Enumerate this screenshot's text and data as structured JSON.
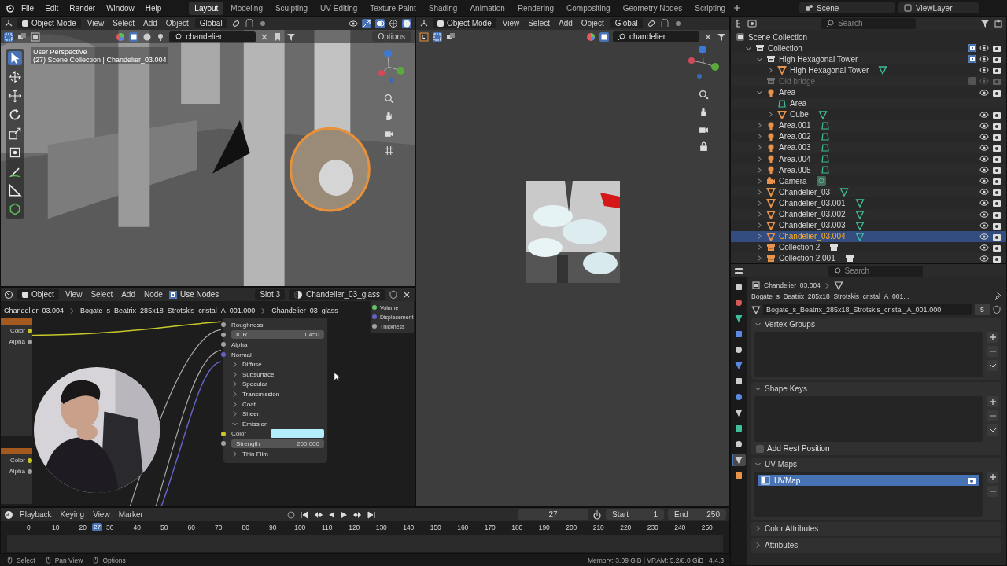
{
  "menu": [
    "File",
    "Edit",
    "Render",
    "Window",
    "Help"
  ],
  "workspaces": [
    {
      "label": "Layout",
      "selected": true
    },
    {
      "label": "Modeling",
      "selected": false
    },
    {
      "label": "Sculpting",
      "selected": false
    },
    {
      "label": "UV Editing",
      "selected": false
    },
    {
      "label": "Texture Paint",
      "selected": false
    },
    {
      "label": "Shading",
      "selected": false
    },
    {
      "label": "Animation",
      "selected": false
    },
    {
      "label": "Rendering",
      "selected": false
    },
    {
      "label": "Compositing",
      "selected": false
    },
    {
      "label": "Geometry Nodes",
      "selected": false
    },
    {
      "label": "Scripting",
      "selected": false
    }
  ],
  "scene": "Scene",
  "view_layer": "ViewLayer",
  "viewport_left": {
    "mode": "Object Mode",
    "menus": [
      "View",
      "Select",
      "Add",
      "Object"
    ],
    "orientation": "Global",
    "search": "chandelier",
    "options": "Options",
    "overlay_title": "User Perspective",
    "overlay_info": "(27) Scene Collection | Chandelier_03.004"
  },
  "viewport_right": {
    "mode": "Object Mode",
    "menus": [
      "View",
      "Select",
      "Add",
      "Object"
    ],
    "orientation": "Global",
    "search": "chandelier"
  },
  "outliner": {
    "search_placeholder": "Search",
    "root": "Scene Collection",
    "tree": [
      {
        "name": "Collection",
        "kind": "collection",
        "expanded": true,
        "checked": true,
        "selected": false,
        "disabled": false,
        "children": [
          {
            "name": "High Hexagonal Tower",
            "kind": "collection",
            "expanded": true,
            "checked": true,
            "selected": false,
            "disabled": false,
            "children": [
              {
                "name": "High Hexagonal Tower",
                "kind": "mesh",
                "badge": {
                  "kind": "mesh"
                },
                "expanded": false,
                "selected": false,
                "disabled": false
              }
            ]
          },
          {
            "name": "Old bridge",
            "kind": "collection",
            "checked": false,
            "selected": false,
            "disabled": true
          },
          {
            "name": "Area",
            "kind": "light",
            "expanded": true,
            "selected": false,
            "disabled": false,
            "children": [
              {
                "name": "Area",
                "kind": "light_data",
                "selected": false,
                "disabled": false
              },
              {
                "name": "Cube",
                "kind": "mesh",
                "badge": {
                  "kind": "mesh"
                },
                "expanded": false,
                "selected": false,
                "disabled": false
              }
            ]
          },
          {
            "name": "Area.001",
            "kind": "light",
            "badge": {
              "kind": "light"
            },
            "expanded": false,
            "selected": false,
            "disabled": false
          },
          {
            "name": "Area.002",
            "kind": "light",
            "badge": {
              "kind": "light"
            },
            "expanded": false,
            "selected": false,
            "disabled": false
          },
          {
            "name": "Area.003",
            "kind": "light",
            "badge": {
              "kind": "light"
            },
            "expanded": false,
            "selected": false,
            "disabled": false
          },
          {
            "name": "Area.004",
            "kind": "light",
            "badge": {
              "kind": "light"
            },
            "expanded": false,
            "selected": false,
            "disabled": false
          },
          {
            "name": "Area.005",
            "kind": "light",
            "badge": {
              "kind": "light"
            },
            "expanded": false,
            "selected": false,
            "disabled": false
          },
          {
            "name": "Camera",
            "kind": "camera",
            "badge": {
              "kind": "camera"
            },
            "expanded": false,
            "selected": false,
            "disabled": false
          },
          {
            "name": "Chandelier_03",
            "kind": "mesh",
            "badge": {
              "kind": "mesh"
            },
            "expanded": false,
            "selected": false,
            "disabled": false
          },
          {
            "name": "Chandelier_03.001",
            "kind": "mesh",
            "badge": {
              "kind": "mesh"
            },
            "expanded": false,
            "selected": false,
            "disabled": false
          },
          {
            "name": "Chandelier_03.002",
            "kind": "mesh",
            "badge": {
              "kind": "mesh"
            },
            "expanded": false,
            "selected": false,
            "disabled": false
          },
          {
            "name": "Chandelier_03.003",
            "kind": "mesh",
            "badge": {
              "kind": "mesh"
            },
            "expanded": false,
            "selected": false,
            "disabled": false
          },
          {
            "name": "Chandelier_03.004",
            "kind": "mesh",
            "badge": {
              "kind": "mesh"
            },
            "expanded": false,
            "selected": true,
            "disabled": false
          },
          {
            "name": "Collection 2",
            "kind": "collection_instance",
            "badge": {
              "kind": "collection"
            },
            "expanded": false,
            "selected": false,
            "disabled": false
          },
          {
            "name": "Collection 2.001",
            "kind": "collection_instance",
            "badge": {
              "kind": "collection"
            },
            "expanded": false,
            "selected": false,
            "disabled": false
          }
        ]
      }
    ]
  },
  "node_editor": {
    "object_mode": "Object",
    "menus": [
      "View",
      "Select",
      "Add",
      "Node"
    ],
    "use_nodes": {
      "label": "Use Nodes",
      "checked": true
    },
    "slot": "Slot 3",
    "material": "Chandelier_03_glass",
    "breadcrumb": [
      "Chandelier_03.004",
      "Bogate_s_Beatrix_285x18_Strotskis_cristal_A_001.000",
      "Chandelier_03_glass"
    ],
    "texture_nodes": [
      {
        "sockets": [
          {
            "label": "Color",
            "color": "#c7c729"
          },
          {
            "label": "Alpha",
            "color": "#a1a1a1"
          }
        ]
      },
      {
        "sockets": [
          {
            "label": "Color",
            "color": "#c7c729"
          },
          {
            "label": "Alpha",
            "color": "#a1a1a1"
          }
        ]
      }
    ],
    "bsdf_rows": [
      {
        "kind": "socket",
        "label": "Roughness",
        "color": "#a1a1a1"
      },
      {
        "kind": "field",
        "label": "IOR",
        "value": "1.450",
        "color": "#a1a1a1"
      },
      {
        "kind": "socket",
        "label": "Alpha",
        "color": "#a1a1a1"
      },
      {
        "kind": "socket",
        "label": "Normal",
        "color": "#6363c7"
      },
      {
        "kind": "panel",
        "label": "Diffuse",
        "expanded": false
      },
      {
        "kind": "panel",
        "label": "Subsurface",
        "expanded": false
      },
      {
        "kind": "panel",
        "label": "Specular",
        "expanded": false
      },
      {
        "kind": "panel",
        "label": "Transmission",
        "expanded": false
      },
      {
        "kind": "panel",
        "label": "Coat",
        "expanded": false
      },
      {
        "kind": "panel",
        "label": "Sheen",
        "expanded": false
      },
      {
        "kind": "panel",
        "label": "Emission",
        "expanded": true
      },
      {
        "kind": "swatch",
        "label": "Color",
        "color": "#c7c729",
        "swatch": {
          "color": "#b3ecfb"
        }
      },
      {
        "kind": "field",
        "label": "Strength",
        "value": "200.000",
        "color": "#a1a1a1"
      },
      {
        "kind": "panel",
        "label": "Thin Film",
        "expanded": false
      }
    ],
    "output_sockets": [
      {
        "label": "Volume",
        "color": "#63c763"
      },
      {
        "label": "Displacement",
        "color": "#6363c7"
      },
      {
        "label": "Thickness",
        "color": "#a1a1a1"
      }
    ]
  },
  "properties": {
    "search_placeholder": "Search",
    "tabs": [
      {
        "selected": false
      },
      {
        "selected": false
      },
      {
        "selected": false
      },
      {
        "selected": false
      },
      {
        "selected": false
      },
      {
        "selected": false
      },
      {
        "selected": false
      },
      {
        "selected": false
      },
      {
        "selected": false
      },
      {
        "selected": false
      },
      {
        "selected": false
      },
      {
        "selected": true
      },
      {
        "selected": false
      }
    ],
    "breadcrumb": [
      "Chandelier_03.004",
      "Bogate_s_Beatrix_285x18_Strotskis_cristal_A_001..."
    ],
    "mesh_name": "Bogate_s_Beatrix_285x18_Strotskis_cristal_A_001.000",
    "users": "5",
    "panels": [
      {
        "title": "Vertex Groups",
        "expanded": true
      },
      {
        "title": "Shape Keys",
        "expanded": true,
        "checkbox": {
          "label": "Add Rest Position",
          "checked": false
        }
      },
      {
        "title": "UV Maps",
        "expanded": true,
        "items": [
          {
            "name": "UVMap",
            "selected": true
          }
        ]
      },
      {
        "title": "Color Attributes",
        "expanded": false
      },
      {
        "title": "Attributes",
        "expanded": false
      }
    ]
  },
  "timeline": {
    "menus": [
      "Playback",
      "Keying",
      "View",
      "Marker"
    ],
    "current_frame": "27",
    "start": {
      "label": "Start",
      "value": "1"
    },
    "end": {
      "label": "End",
      "value": "250"
    },
    "ticks": [
      "0",
      "10",
      "20",
      "30",
      "40",
      "50",
      "60",
      "70",
      "80",
      "90",
      "100",
      "110",
      "120",
      "130",
      "140",
      "150",
      "160",
      "170",
      "180",
      "190",
      "200",
      "210",
      "220",
      "230",
      "240",
      "250"
    ],
    "playhead": "27"
  },
  "status_bar": {
    "hints": [
      "Select",
      "Pan View",
      "Options"
    ],
    "stats": "Memory: 3.09 GiB | VRAM: 5.2/8.0 GiB | 4.4.3"
  }
}
